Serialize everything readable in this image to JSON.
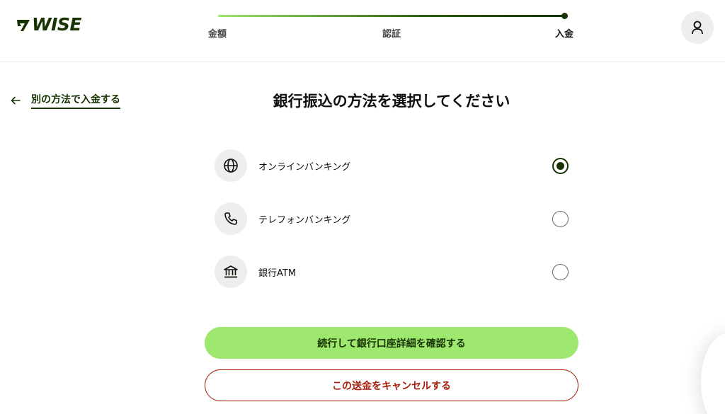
{
  "brand": {
    "name": "WISE",
    "color": "#163300",
    "accent": "#9fe870"
  },
  "stepper": {
    "steps": [
      {
        "label": "金額"
      },
      {
        "label": "認証"
      },
      {
        "label": "入金"
      }
    ],
    "current_step": 3,
    "progress": 1.0
  },
  "header": {
    "profile_icon": "user-icon"
  },
  "back_link": {
    "label": "別の方法で入金する",
    "icon": "arrow-left-icon"
  },
  "page_title": "銀行振込の方法を選択してください",
  "options": [
    {
      "label": "オンラインバンキング",
      "icon": "globe-icon",
      "selected": true
    },
    {
      "label": "テレフォンバンキング",
      "icon": "phone-icon",
      "selected": false
    },
    {
      "label": "銀行ATM",
      "icon": "bank-icon",
      "selected": false
    }
  ],
  "actions": {
    "continue_label": "続行して銀行口座詳細を確認する",
    "cancel_label": "この送金をキャンセルする"
  },
  "colors": {
    "danger": "#a8200d",
    "icon_bg": "#eeefec"
  }
}
